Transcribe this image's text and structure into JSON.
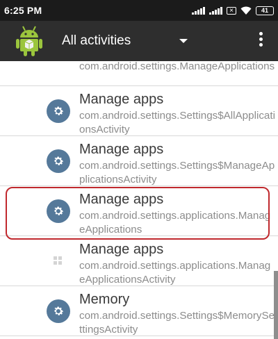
{
  "status_bar": {
    "time": "6:25 PM",
    "battery": "41"
  },
  "toolbar": {
    "title": "All activities"
  },
  "rows": [
    {
      "title": "",
      "subtitle": "com.android.settings.ManageApplications"
    },
    {
      "title": "Manage apps",
      "subtitle": "com.android.settings.Settings$AllApplicationsActivity"
    },
    {
      "title": "Manage apps",
      "subtitle": "com.android.settings.Settings$ManageApplicationsActivity"
    },
    {
      "title": "Manage apps",
      "subtitle": "com.android.settings.applications.ManageApplications"
    },
    {
      "title": "Manage apps",
      "subtitle": "com.android.settings.applications.ManageApplicationsActivity"
    },
    {
      "title": "Memory",
      "subtitle": "com.android.settings.Settings$MemorySettingsActivity"
    }
  ],
  "colors": {
    "accent_highlight": "#c0282d",
    "icon_bg": "#55799a",
    "toolbar_bg": "#2e2e2e"
  },
  "icons": [
    "android-logo-icon",
    "gear-icon",
    "grid-icon",
    "overflow-menu-icon",
    "dropdown-arrow-icon"
  ]
}
